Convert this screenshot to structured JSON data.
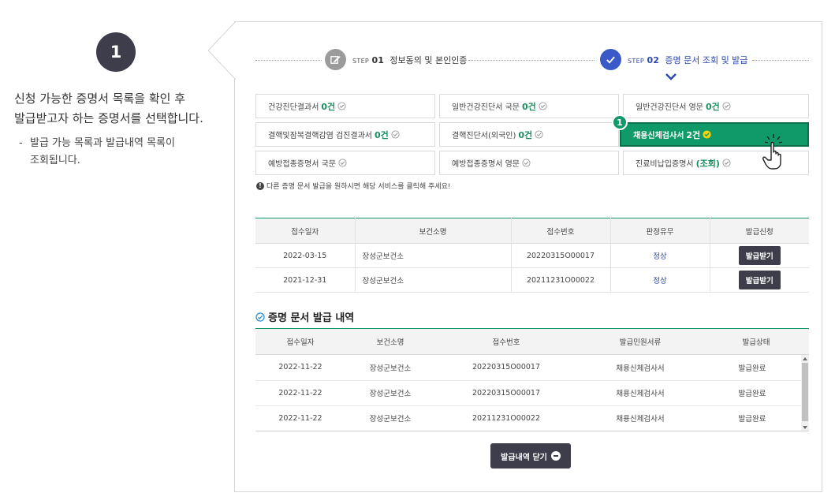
{
  "guide": {
    "step_number": "1",
    "line1": "신청 가능한 증명서 목록을 확인 후",
    "line2": "발급받고자 하는 증명서를 선택합니다.",
    "sub_line1": "발급 가능 목록과 발급내역 목록이",
    "sub_line2": "조회됩니다."
  },
  "stepper": {
    "step1": {
      "pre": "STEP",
      "num": "01",
      "label": "정보동의 및 본인인증"
    },
    "step2": {
      "pre": "STEP",
      "num": "02",
      "label": "증명 문서 조회 및 발급"
    }
  },
  "certificates": [
    {
      "name": "건강진단결과서",
      "count": "0건"
    },
    {
      "name": "일반건강진단서 국문",
      "count": "0건"
    },
    {
      "name": "일반건강진단서 영문",
      "count": "0건"
    },
    {
      "name": "결핵및잠복결핵감염 검진결과서",
      "count": "0건"
    },
    {
      "name": "결핵진단서(외국인)",
      "count": "0건"
    },
    {
      "name": "채용신체검사서",
      "count": "2건",
      "badge": "1"
    },
    {
      "name": "예방접종증명서 국문",
      "count": ""
    },
    {
      "name": "예방접종증명서 영문",
      "count": ""
    },
    {
      "name": "진료비납입증명서",
      "count": "(조회)"
    }
  ],
  "notice": "다른 증명 문서 발급을 원하시면 해당 서비스를 클릭해 주세요!",
  "issue_table": {
    "headers": [
      "접수일자",
      "보건소명",
      "접수번호",
      "판정유무",
      "발급신청"
    ],
    "rows": [
      {
        "date": "2022-03-15",
        "center": "장성군보건소",
        "number": "20220315O00017",
        "result": "정상",
        "action": "발급받기"
      },
      {
        "date": "2021-12-31",
        "center": "장성군보건소",
        "number": "20211231O00022",
        "result": "정상",
        "action": "발급받기"
      }
    ]
  },
  "history": {
    "title": "증명 문서 발급 내역",
    "headers": [
      "접수일자",
      "보건소명",
      "접수번호",
      "발급민원서류",
      "발급상태"
    ],
    "rows": [
      {
        "date": "2022-11-22",
        "center": "장성군보건소",
        "number": "20220315O00017",
        "doc": "채용신체검사서",
        "status": "발급완료"
      },
      {
        "date": "2022-11-22",
        "center": "장성군보건소",
        "number": "20220315O00017",
        "doc": "채용신체검사서",
        "status": "발급완료"
      },
      {
        "date": "2022-11-22",
        "center": "장성군보건소",
        "number": "20211231O00022",
        "doc": "채용신체검사서",
        "status": "발급완료"
      }
    ],
    "close_label": "발급내역 닫기"
  },
  "colors": {
    "accent_green": "#119a69",
    "step_blue": "#3a5bc7",
    "dark_button": "#3d3d4b"
  }
}
